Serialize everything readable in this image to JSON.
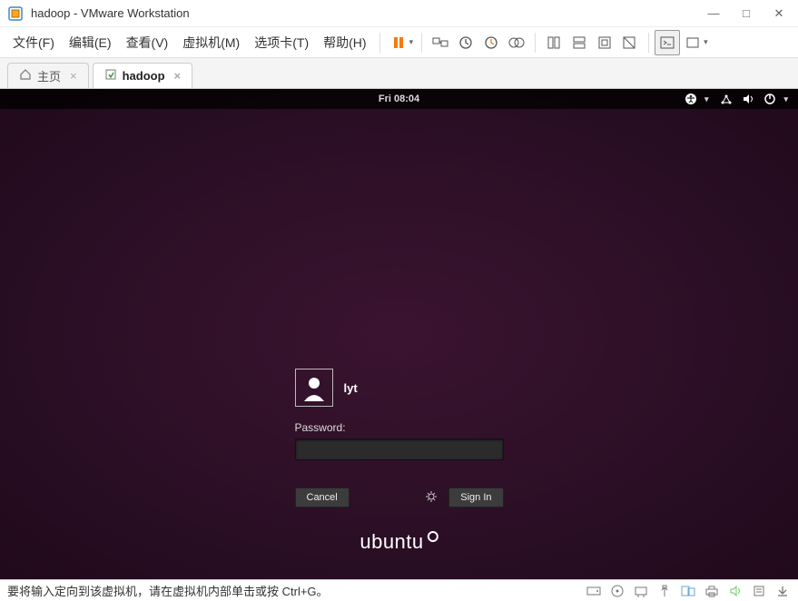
{
  "window": {
    "title": "hadoop - VMware Workstation",
    "controls": {
      "min": "—",
      "max": "□",
      "close": "✕"
    }
  },
  "menu": {
    "file": "文件(F)",
    "edit": "编辑(E)",
    "view": "查看(V)",
    "vm": "虚拟机(M)",
    "tabs": "选项卡(T)",
    "help": "帮助(H)"
  },
  "tabs": {
    "home": "主页",
    "active": "hadoop"
  },
  "ubuntu": {
    "clock": "Fri 08:04",
    "username": "lyt",
    "password_label": "Password:",
    "password_value": "",
    "cancel": "Cancel",
    "signin": "Sign In",
    "brand": "ubuntu"
  },
  "statusbar": {
    "hint": "要将输入定向到该虚拟机，请在虚拟机内部单击或按 Ctrl+G。"
  }
}
